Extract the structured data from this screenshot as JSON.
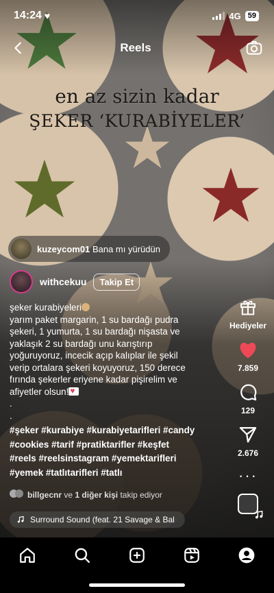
{
  "status_bar": {
    "time": "14:24",
    "network": "4G",
    "battery": "59"
  },
  "header": {
    "title": "Reels"
  },
  "video_overlay": {
    "line1": "en az sizin kadar",
    "line2": "ŞEKER ‘KURABİYELER’"
  },
  "reply": {
    "username": "kuzeycom01",
    "text": "Bana mı yürüdün"
  },
  "author": {
    "username": "withcekuu",
    "follow_label": "Takip Et"
  },
  "caption": {
    "lines": [
      "şeker kurabiyeleri",
      "yarım paket margarin, 1 su bardağı pudra",
      "şekeri, 1 yumurta, 1 su bardağı nişasta ve",
      "yaklaşık 2 su bardağı unu karıştırıp",
      "yoğuruyoruz, incecik açıp kalıplar ile şekil",
      "verip ortalara şekeri koyuyoruz, 150 derece",
      "fırında şekerler eriyene kadar pişirelim ve",
      "afiyetler olsun!",
      ".",
      "."
    ],
    "hashtags": [
      "#şeker #kurabiye #kurabiyetarifleri #candy",
      "#cookies #tarif #pratiktarifler #keşfet",
      "#reels #reelsinstagram #yemektarifleri",
      "#yemek #tatlıtarifleri #tatlı"
    ]
  },
  "followers_line": {
    "user": "billgecnr",
    "rest": "ve",
    "others": "1 diğer kişi",
    "suffix": "takip ediyor"
  },
  "music": {
    "title": "Surround Sound (feat. 21 Savage & Bal"
  },
  "actions": {
    "gifts_label": "Hediyeler",
    "likes": "7.859",
    "comments": "129",
    "shares": "2.676"
  },
  "colors": {
    "like": "#ed4956",
    "follow_ring": "#d63b8b"
  },
  "icons": [
    "back-icon",
    "camera-icon",
    "gift-icon",
    "heart-icon",
    "comment-icon",
    "send-icon",
    "more-icon",
    "music-note-icon",
    "home-icon",
    "search-icon",
    "create-icon",
    "reels-icon",
    "profile-icon"
  ]
}
